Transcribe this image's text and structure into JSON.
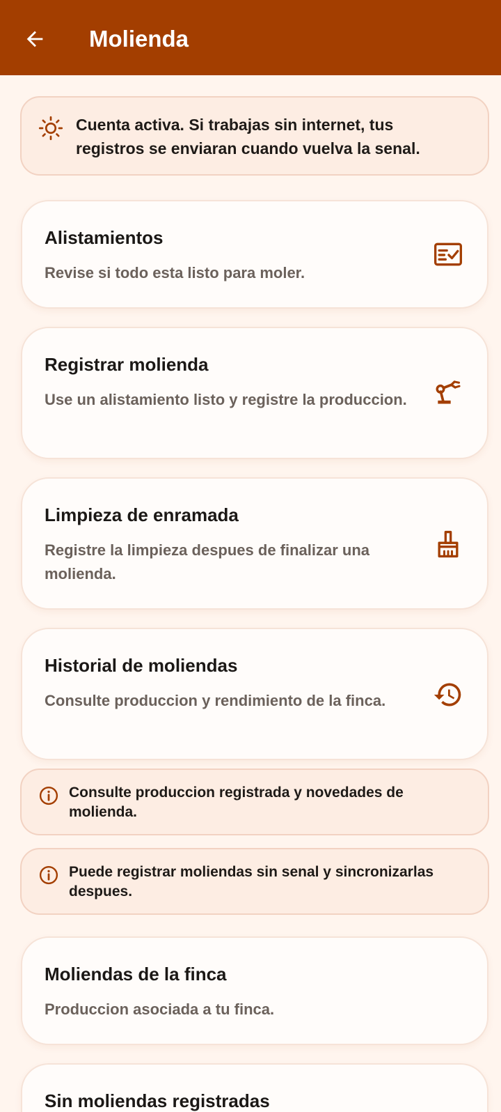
{
  "appbar": {
    "title": "Molienda",
    "back_icon": "arrow-back-icon"
  },
  "status_banner": {
    "icon": "sun-icon",
    "text": "Cuenta activa. Si trabajas sin internet, tus registros se enviaran cuando vuelva la senal."
  },
  "actions": [
    {
      "title": "Alistamientos",
      "subtitle": "Revise si todo esta listo para moler.",
      "icon": "checklist-icon"
    },
    {
      "title": "Registrar molienda",
      "subtitle": "Use un alistamiento listo y registre la produccion.",
      "icon": "mill-machine-icon"
    },
    {
      "title": "Limpieza de enramada",
      "subtitle": "Registre la limpieza despues de finalizar una molienda.",
      "icon": "broom-icon"
    },
    {
      "title": "Historial de moliendas",
      "subtitle": "Consulte produccion y rendimiento de la finca.",
      "icon": "history-icon"
    }
  ],
  "info_banners": [
    {
      "text": "Consulte produccion registrada y novedades de molienda.",
      "icon": "info-icon"
    },
    {
      "text": "Puede registrar moliendas sin senal y sincronizarlas despues.",
      "icon": "info-icon"
    }
  ],
  "farm_section": {
    "title": "Moliendas de la finca",
    "subtitle": "Produccion asociada a tu finca."
  },
  "empty_state": {
    "title": "Sin moliendas registradas"
  },
  "colors": {
    "primary": "#A33E00",
    "background": "#FFF5EE",
    "card": "#FFFCFA",
    "banner": "#FDEDE3",
    "text": "#1B1816",
    "muted": "#6B615B"
  }
}
